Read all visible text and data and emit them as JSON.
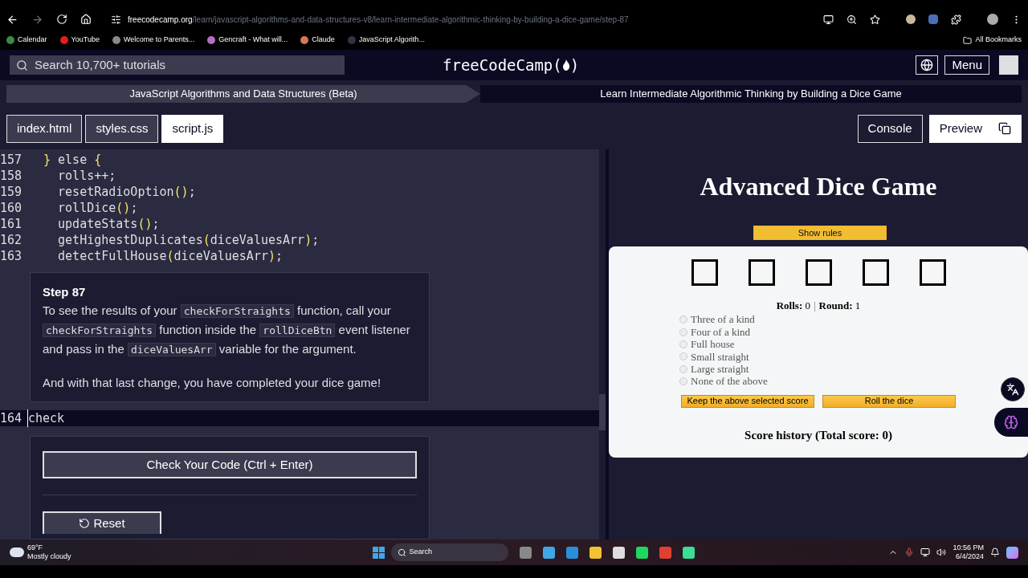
{
  "browser": {
    "url_host": "freecodecamp.org",
    "url_path": "/learn/javascript-algorithms-and-data-structures-v8/learn-intermediate-algorithmic-thinking-by-building-a-dice-game/step-87",
    "bookmarks": [
      {
        "label": "Calendar"
      },
      {
        "label": "YouTube"
      },
      {
        "label": "Welcome to Parents..."
      },
      {
        "label": "Gencraft - What will..."
      },
      {
        "label": "Claude"
      },
      {
        "label": "JavaScript Algorith..."
      }
    ],
    "all_bookmarks": "All Bookmarks"
  },
  "navbar": {
    "search_placeholder": "Search 10,700+ tutorials",
    "logo": [
      "freeCodeCamp(",
      ")"
    ],
    "menu": "Menu"
  },
  "breadcrumb": [
    "JavaScript Algorithms and Data Structures (Beta)",
    "Learn Intermediate Algorithmic Thinking by Building a Dice Game"
  ],
  "file_tabs": [
    {
      "label": "index.html",
      "selected": false
    },
    {
      "label": "styles.css",
      "selected": false
    },
    {
      "label": "script.js",
      "selected": true
    }
  ],
  "view_buttons": [
    {
      "label": "Console",
      "selected": false
    },
    {
      "label": "Preview",
      "selected": true
    }
  ],
  "code_lines": [
    {
      "number": "157",
      "text": "} else {"
    },
    {
      "number": "158",
      "text": "  rolls++;"
    },
    {
      "number": "159",
      "text": "  resetRadioOption();"
    },
    {
      "number": "160",
      "text": "  rollDice();"
    },
    {
      "number": "161",
      "text": "  updateStats();"
    },
    {
      "number": "162",
      "text": "  getHighestDuplicates(diceValuesArr);"
    },
    {
      "number": "163",
      "text": "  detectFullHouse(diceValuesArr);"
    }
  ],
  "step": {
    "title": "Step 87",
    "paragraphs": [
      [
        {
          "kind": "text",
          "text": "To see the results of your "
        },
        {
          "kind": "code",
          "text": "checkForStraights"
        },
        {
          "kind": "text",
          "text": " function, call your "
        },
        {
          "kind": "code",
          "text": "checkForStraights"
        },
        {
          "kind": "text",
          "text": " function inside the "
        },
        {
          "kind": "code",
          "text": "rollDiceBtn"
        },
        {
          "kind": "text",
          "text": " event listener and pass in the "
        },
        {
          "kind": "code",
          "text": "diceValuesArr"
        },
        {
          "kind": "text",
          "text": " variable for the argument."
        }
      ],
      [
        {
          "kind": "text",
          "text": "And with that last change, you have completed your dice game!"
        }
      ]
    ]
  },
  "edit_line": {
    "number": "164",
    "text": "check"
  },
  "actions": {
    "check": "Check Your Code (Ctrl + Enter)",
    "reset": "Reset"
  },
  "preview": {
    "title": "Advanced Dice Game",
    "show_rules": "Show rules",
    "dice": [
      {
        "kind": "empty"
      },
      {
        "kind": "empty"
      },
      {
        "kind": "empty"
      },
      {
        "kind": "empty"
      },
      {
        "kind": "empty"
      }
    ],
    "stats": [
      {
        "label": "Rolls:",
        "value": "0"
      },
      {
        "label": "Round:",
        "value": "1"
      }
    ],
    "stats_separator": "|",
    "options": [
      {
        "label": "Three of a kind",
        "selected": false
      },
      {
        "label": "Four of a kind",
        "selected": false
      },
      {
        "label": "Full house",
        "selected": false
      },
      {
        "label": "Small straight",
        "selected": false
      },
      {
        "label": "Large straight",
        "selected": false
      },
      {
        "label": "None of the above",
        "selected": false
      }
    ],
    "buttons": [
      "Keep the above selected score",
      "Roll the dice"
    ],
    "score_history": "Score history (Total score: 0)"
  },
  "taskbar": {
    "temperature": "69°F",
    "weather": "Mostly cloudy",
    "search": "Search",
    "time": "10:56 PM",
    "date": "6/4/2024"
  }
}
